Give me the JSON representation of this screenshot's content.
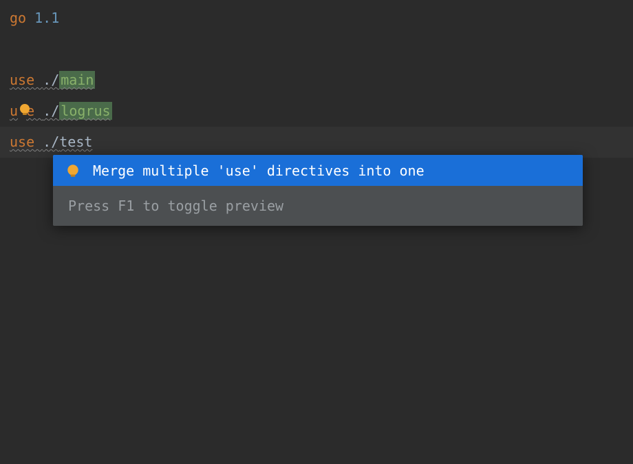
{
  "code": {
    "line1": {
      "go": "go",
      "version": "1.1"
    },
    "line3": {
      "use": "use ",
      "dot": "./",
      "path": "main"
    },
    "line4": {
      "u": "u",
      "e": "e ",
      "dot": "./",
      "path": "logrus"
    },
    "line5": {
      "use": "use ",
      "dot": "./",
      "path": "test"
    }
  },
  "popup": {
    "action": "Merge multiple 'use' directives into one",
    "footer": "Press F1 to toggle preview"
  },
  "colors": {
    "bulb": "#f0a732"
  }
}
